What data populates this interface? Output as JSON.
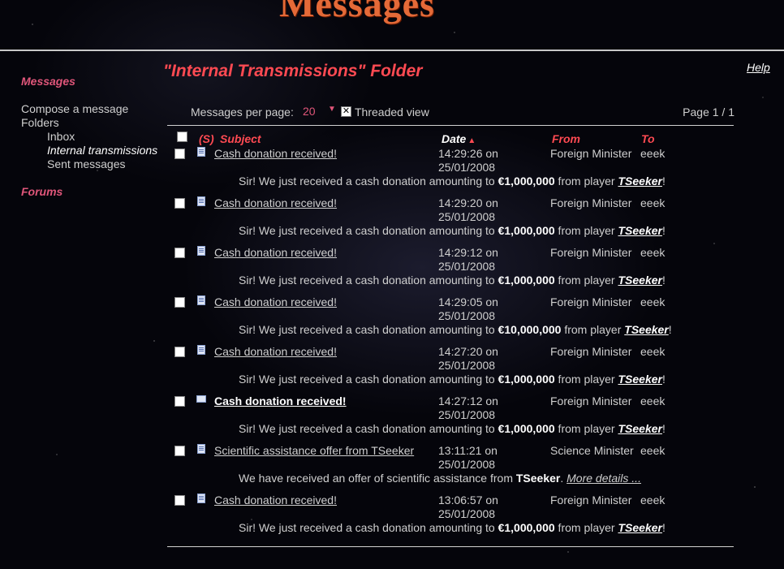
{
  "header": {
    "title": "Messages"
  },
  "sidebar": {
    "messages_label": "Messages",
    "compose_label": "Compose a message",
    "folders_label": "Folders",
    "folders": [
      {
        "label": "Inbox",
        "current": false
      },
      {
        "label": "Internal transmissions",
        "current": true
      },
      {
        "label": "Sent messages",
        "current": false
      }
    ],
    "forums_label": "Forums"
  },
  "main": {
    "folder_title": "\"Internal Transmissions\" Folder",
    "help_label": "Help",
    "per_page_label": "Messages per page:",
    "per_page_value": "20",
    "threaded_label": "Threaded view",
    "threaded_checked": true,
    "page_info": "Page 1 / 1",
    "columns": {
      "s": "(S)",
      "subject": "Subject",
      "date": "Date",
      "from": "From",
      "to": "To"
    }
  },
  "messages": [
    {
      "subject": "Cash donation received!",
      "unread": false,
      "icon": "document-icon",
      "date_time": "14:29:26 on",
      "date_day": "25/01/2008",
      "from": "Foreign Minister",
      "to": "eeek",
      "body_pre": "Sir! We just received a cash donation amounting to ",
      "amount": "€1,000,000",
      "body_mid": " from player ",
      "player": "TSeeker",
      "body_post": "!"
    },
    {
      "subject": "Cash donation received!",
      "unread": false,
      "icon": "document-icon",
      "date_time": "14:29:20 on",
      "date_day": "25/01/2008",
      "from": "Foreign Minister",
      "to": "eeek",
      "body_pre": "Sir! We just received a cash donation amounting to ",
      "amount": "€1,000,000",
      "body_mid": " from player ",
      "player": "TSeeker",
      "body_post": "!"
    },
    {
      "subject": "Cash donation received!",
      "unread": false,
      "icon": "document-icon",
      "date_time": "14:29:12 on",
      "date_day": "25/01/2008",
      "from": "Foreign Minister",
      "to": "eeek",
      "body_pre": "Sir! We just received a cash donation amounting to ",
      "amount": "€1,000,000",
      "body_mid": " from player ",
      "player": "TSeeker",
      "body_post": "!"
    },
    {
      "subject": "Cash donation received!",
      "unread": false,
      "icon": "document-icon",
      "date_time": "14:29:05 on",
      "date_day": "25/01/2008",
      "from": "Foreign Minister",
      "to": "eeek",
      "body_pre": "Sir! We just received a cash donation amounting to ",
      "amount": "€10,000,000",
      "body_mid": " from player ",
      "player": "TSeeker",
      "body_post": "!"
    },
    {
      "subject": "Cash donation received!",
      "unread": false,
      "icon": "document-icon",
      "date_time": "14:27:20 on",
      "date_day": "25/01/2008",
      "from": "Foreign Minister",
      "to": "eeek",
      "body_pre": "Sir! We just received a cash donation amounting to ",
      "amount": "€1,000,000",
      "body_mid": " from player ",
      "player": "TSeeker",
      "body_post": "!"
    },
    {
      "subject": "Cash donation received!",
      "unread": true,
      "icon": "envelope-icon",
      "date_time": "14:27:12 on",
      "date_day": "25/01/2008",
      "from": "Foreign Minister",
      "to": "eeek",
      "body_pre": "Sir! We just received a cash donation amounting to ",
      "amount": "€1,000,000",
      "body_mid": " from player ",
      "player": "TSeeker",
      "body_post": "!"
    },
    {
      "subject": "Scientific assistance offer from TSeeker",
      "unread": false,
      "icon": "document-icon",
      "date_time": "13:11:21 on",
      "date_day": "25/01/2008",
      "from": "Science Minister",
      "to": "eeek",
      "body_pre": "We have received an offer of scientific assistance from ",
      "amount": "TSeeker",
      "body_mid": ". ",
      "more": "More details ...",
      "player": "",
      "body_post": ""
    },
    {
      "subject": "Cash donation received!",
      "unread": false,
      "icon": "document-icon",
      "date_time": "13:06:57 on",
      "date_day": "25/01/2008",
      "from": "Foreign Minister",
      "to": "eeek",
      "body_pre": "Sir! We just received a cash donation amounting to ",
      "amount": "€1,000,000",
      "body_mid": " from player ",
      "player": "TSeeker",
      "body_post": "!"
    }
  ]
}
